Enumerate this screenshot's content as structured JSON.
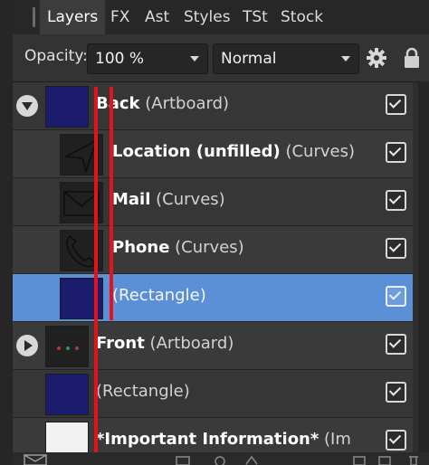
{
  "tabs": [
    {
      "label": "Layers"
    },
    {
      "label": "FX"
    },
    {
      "label": "Ast"
    },
    {
      "label": "Styles"
    },
    {
      "label": "TSt"
    },
    {
      "label": "Stock"
    }
  ],
  "toolbar": {
    "opacity_label": "Opacity:",
    "opacity_value": "100 %",
    "blend_mode": "Normal"
  },
  "layers": [
    {
      "name": "Back",
      "type": "(Artboard)",
      "visible": true
    },
    {
      "name": "Location (unfilled)",
      "type": "(Curves)",
      "visible": true
    },
    {
      "name": "Mail",
      "type": "(Curves)",
      "visible": true
    },
    {
      "name": "Phone",
      "type": "(Curves)",
      "visible": true
    },
    {
      "name": "",
      "type": "(Rectangle)",
      "visible": true,
      "selected": true
    },
    {
      "name": "Front",
      "type": "(Artboard)",
      "visible": true
    },
    {
      "name": "",
      "type": "(Rectangle)",
      "visible": true
    },
    {
      "name": "*Important Information*",
      "type": "(Im",
      "visible": true
    }
  ],
  "colors": {
    "selection": "#5b8fd6",
    "annotation_red": "#e3121b",
    "artboard_thumb": "#1b1c6e"
  }
}
